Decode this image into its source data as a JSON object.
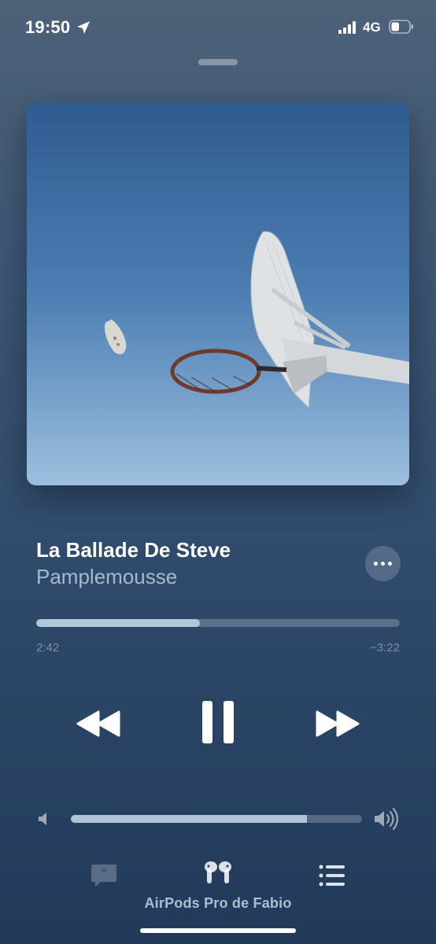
{
  "status_bar": {
    "time": "19:50",
    "network": "4G",
    "icons": [
      "location-arrow-icon",
      "cellular-signal-icon",
      "battery-icon"
    ],
    "battery_level": 0.45
  },
  "now_playing": {
    "title": "La Ballade De Steve",
    "artist": "Pamplemousse",
    "artwork": "basketball hoop against blue sky",
    "more_icon": "ellipsis-icon"
  },
  "progress": {
    "elapsed": "2:42",
    "remaining": "−3:22",
    "fraction": 0.45
  },
  "controls": {
    "rewind_icon": "rewind-icon",
    "pause_icon": "pause-icon",
    "forward_icon": "fast-forward-icon"
  },
  "volume": {
    "level": 0.81,
    "low_icon": "speaker-low-icon",
    "high_icon": "speaker-high-icon"
  },
  "bottom_bar": {
    "device_name": "AirPods Pro de Fabio",
    "icons": [
      "lyrics-icon",
      "airpods-icon",
      "queue-list-icon"
    ]
  },
  "colors": {
    "background_top": "#4d6279",
    "background_bottom": "#223a5a",
    "accent": "#c8dcf0"
  }
}
